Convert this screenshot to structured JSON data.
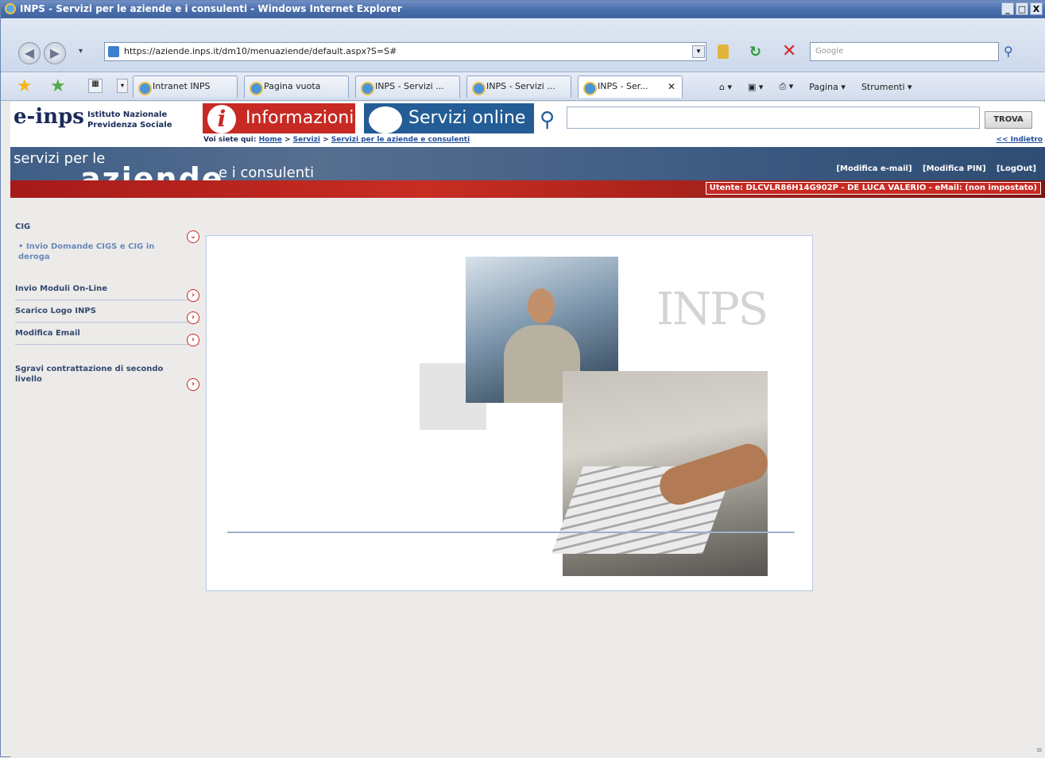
{
  "window": {
    "title": "INPS - Servizi per le aziende e i consulenti - Windows Internet Explorer",
    "buttons": [
      "_",
      "□",
      "X"
    ]
  },
  "address": {
    "url": "https://aziende.inps.it/dm10/menuaziende/default.aspx?S=S#",
    "search_placeholder": "Google"
  },
  "tabs": [
    {
      "label": "Intranet INPS"
    },
    {
      "label": "Pagina vuota"
    },
    {
      "label": "INPS - Servizi ..."
    },
    {
      "label": "INPS - Servizi ..."
    },
    {
      "label": "INPS - Ser..."
    }
  ],
  "command_bar": {
    "page": "Pagina",
    "tools": "Strumenti"
  },
  "site": {
    "logo": "e-inps",
    "org_line1": "Istituto Nazionale",
    "org_line2": "Previdenza Sociale",
    "info_tab": "Informazioni",
    "services_tab": "Servizi online",
    "search_button": "TROVA",
    "breadcrumb_prefix": "Voi siete qui:",
    "breadcrumb": [
      "Home",
      "Servizi",
      "Servizi per le aziende e consulenti"
    ],
    "back_link": "<< Indietro",
    "banner_line1": "servizi per le",
    "banner_line2": "aziende",
    "banner_line3": "e i consulenti",
    "links": [
      "[Modifica e-mail]",
      "[Modifica PIN]",
      "[LogOut]"
    ],
    "user_info": "Utente: DLCVLR86H14G902P - DE LUCA VALERIO - eMail: (non impostato)"
  },
  "sidebar": {
    "items": [
      {
        "label": "CIG"
      },
      {
        "label": "Invio Moduli On-Line"
      },
      {
        "label": "Scarico Logo INPS"
      },
      {
        "label": "Modifica Email"
      },
      {
        "label": "Sgravi contrattazione di secondo livello"
      }
    ],
    "subitem": "• Invio Domande CIGS e CIG in deroga"
  },
  "content": {
    "watermark": "INPS"
  },
  "colors": {
    "accent_red": "#c62a23",
    "accent_blue": "#245d95"
  }
}
